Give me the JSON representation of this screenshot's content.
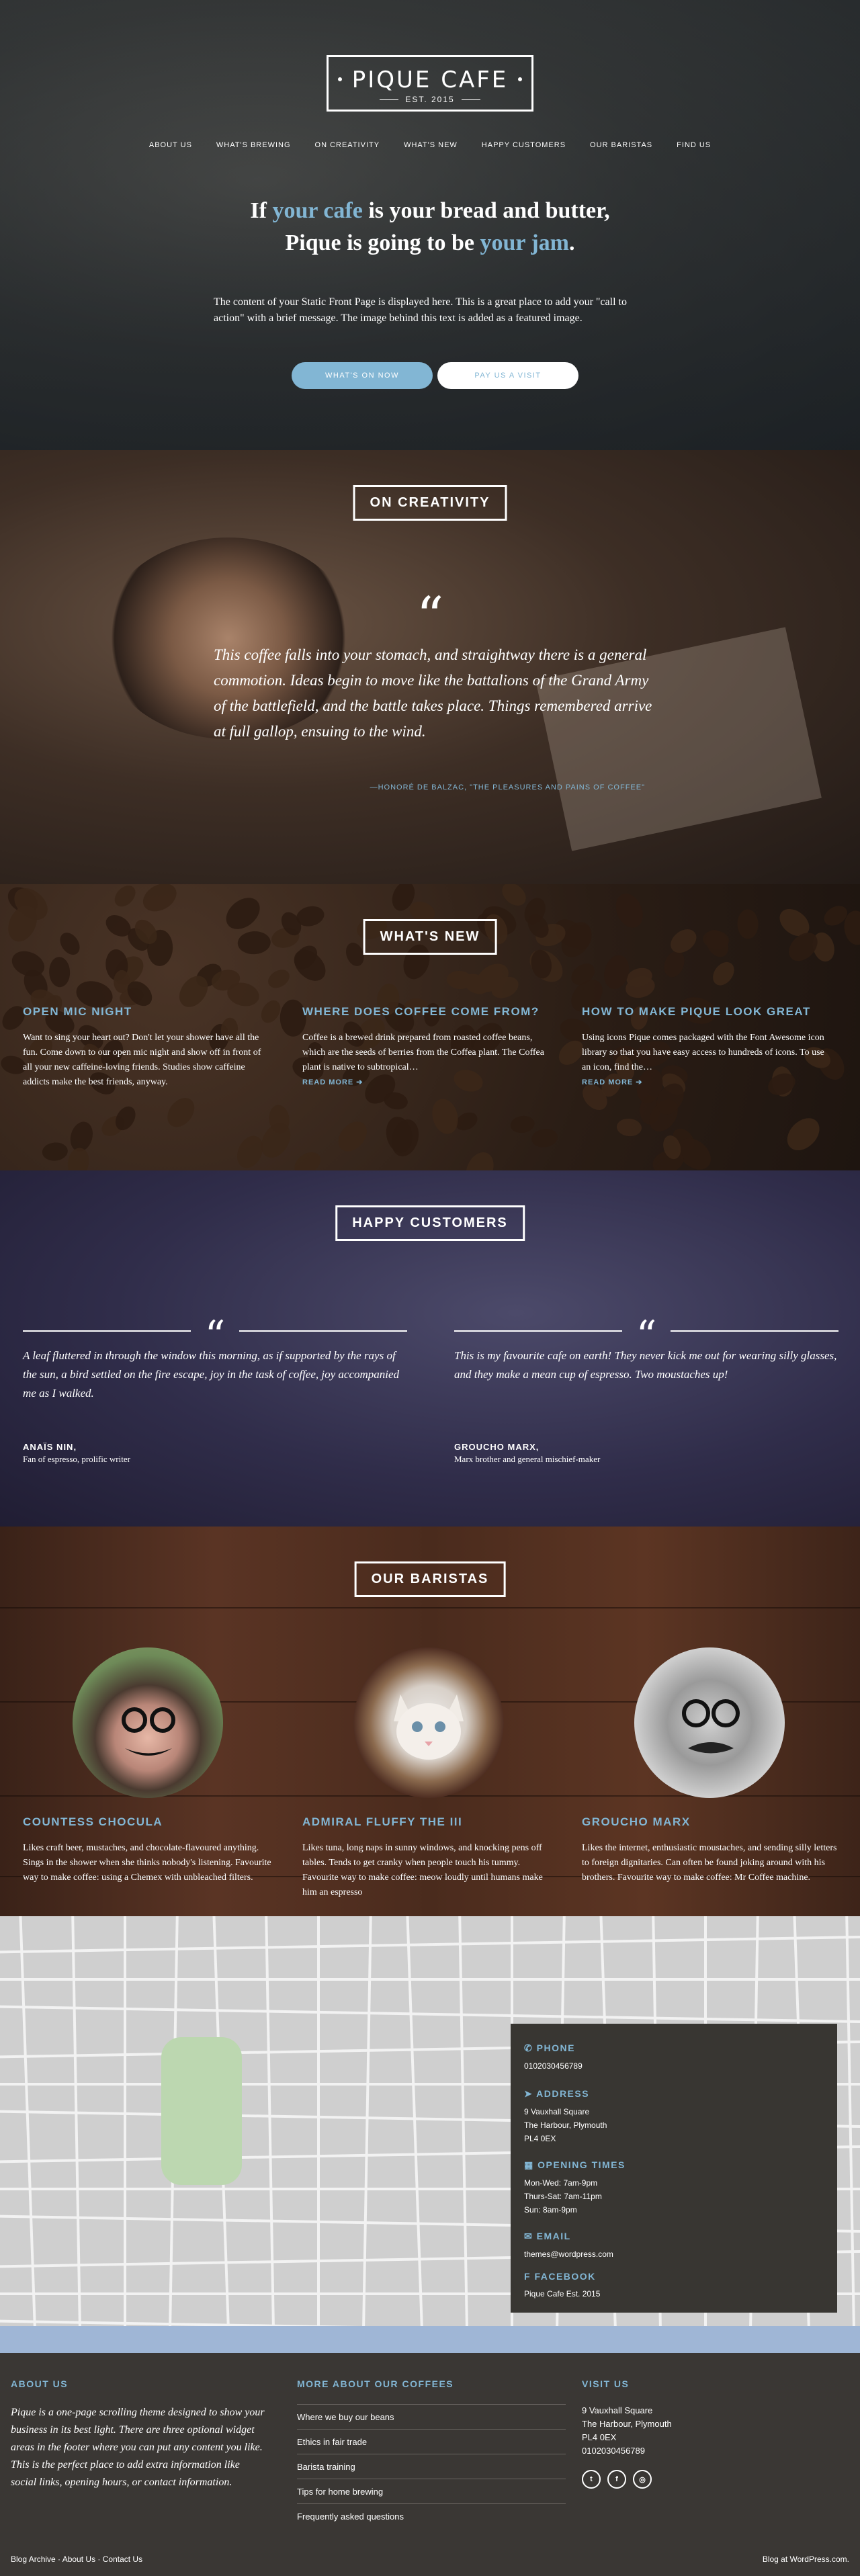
{
  "header": {
    "logo_title": "PIQUE CAFE",
    "logo_est": "EST. 2015",
    "nav": [
      "About Us",
      "What's Brewing",
      "On Creativity",
      "What's New",
      "Happy Customers",
      "Our Baristas",
      "Find Us"
    ]
  },
  "hero": {
    "headline_1a": "If ",
    "headline_1b": "your cafe",
    "headline_1c": " is your bread and butter,",
    "headline_2a": "Pique is going to be ",
    "headline_2b": "your jam",
    "headline_2c": ".",
    "text": "The content of your Static Front Page is displayed here. This is a great place to add your \"call to action\" with a brief message. The image behind this text is added as a featured image.",
    "button_primary": "What's on now",
    "button_secondary": "Pay us a visit"
  },
  "creativity": {
    "title": "On Creativity",
    "quote_mark": "“",
    "quote": "This coffee falls into your stomach, and straightway there is a general commotion. Ideas begin to move like the battalions of the Grand Army of the battlefield, and the battle takes place. Things remembered arrive at full gallop, ensuing to the wind.",
    "cite": "—Honoré de Balzac, \"The Pleasures and Pains of Coffee\""
  },
  "whats_new": {
    "title": "What's New",
    "posts": [
      {
        "title": "Open Mic Night",
        "excerpt": "Want to sing your heart out? Don't let your shower have all the fun. Come down to our open mic night and show off in front of all your new caffeine-loving friends. Studies show caffeine addicts make the best friends, anyway.",
        "more": ""
      },
      {
        "title": "Where does coffee come from?",
        "excerpt": "Coffee is a brewed drink prepared from roasted coffee beans, which are the seeds of berries from the Coffea plant. The Coffea plant is native to subtropical…",
        "more": "Read more ➔"
      },
      {
        "title": "How to make Pique look great",
        "excerpt": "Using icons Pique comes packaged with the Font Awesome icon library so that you have easy access to hundreds of icons. To use an icon, find the…",
        "more": "Read more ➔"
      }
    ]
  },
  "customers": {
    "title": "Happy Customers",
    "quote_mark": "“",
    "testimonials": [
      {
        "quote": "A leaf fluttered in through the window this morning, as if supported by the rays of the sun, a bird settled on the fire escape, joy in the task of coffee, joy accompanied me as I walked.",
        "name": "Anaïs Nin,",
        "role": "Fan of espresso, prolific writer"
      },
      {
        "quote": "This is my favourite cafe on earth! They never kick me out for wearing silly glasses, and they make a mean cup of espresso. Two moustaches up!",
        "name": "Groucho Marx,",
        "role": "Marx brother and general mischief-maker"
      }
    ]
  },
  "baristas": {
    "title": "Our Baristas",
    "people": [
      {
        "name": "Countess Chocula",
        "bio": "Likes craft beer, mustaches, and chocolate-flavoured anything. Sings in the shower when she thinks nobody's listening. Favourite way to make coffee: using a Chemex with unbleached filters."
      },
      {
        "name": "Admiral Fluffy the III",
        "bio": "Likes tuna, long naps in sunny windows, and knocking pens off tables. Tends to get cranky when people touch his tummy. Favourite way to make coffee: meow loudly until humans make him an espresso"
      },
      {
        "name": "Groucho Marx",
        "bio": "Likes the internet, enthusiastic moustaches, and sending silly letters to foreign dignitaries. Can often be found joking around with his brothers. Favourite way to make coffee: Mr Coffee machine."
      }
    ]
  },
  "contact": {
    "phone_label": "Phone",
    "phone": "0102030456789",
    "address_label": "Address",
    "address": [
      "9 Vauxhall Square",
      "The Harbour, Plymouth",
      "PL4 0EX"
    ],
    "hours_label": "Opening Times",
    "hours": [
      "Mon-Wed: 7am-9pm",
      "Thurs-Sat: 7am-11pm",
      "Sun: 8am-9pm"
    ],
    "email_label": "Email",
    "email": "themes@wordpress.com",
    "facebook_label": "Facebook",
    "facebook": "Pique Cafe Est. 2015"
  },
  "footer": {
    "about_title": "About Us",
    "about_text": "Pique is a one-page scrolling theme designed to show your business in its best light. There are three optional widget areas in the footer where you can put any content you like. This is the perfect place to add extra information like social links, opening hours, or contact information.",
    "more_title": "More About Our Coffees",
    "links": [
      "Where we buy our beans",
      "Ethics in fair trade",
      "Barista training",
      "Tips for home brewing",
      "Frequently asked questions"
    ],
    "visit_title": "Visit Us",
    "visit": [
      "9 Vauxhall Square",
      "The Harbour, Plymouth",
      "PL4 0EX",
      "0102030456789"
    ],
    "social": [
      "t",
      "f",
      "◎"
    ],
    "bottom_left": "Blog Archive · About Us · Contact Us",
    "bottom_right": "Blog at WordPress.com."
  }
}
